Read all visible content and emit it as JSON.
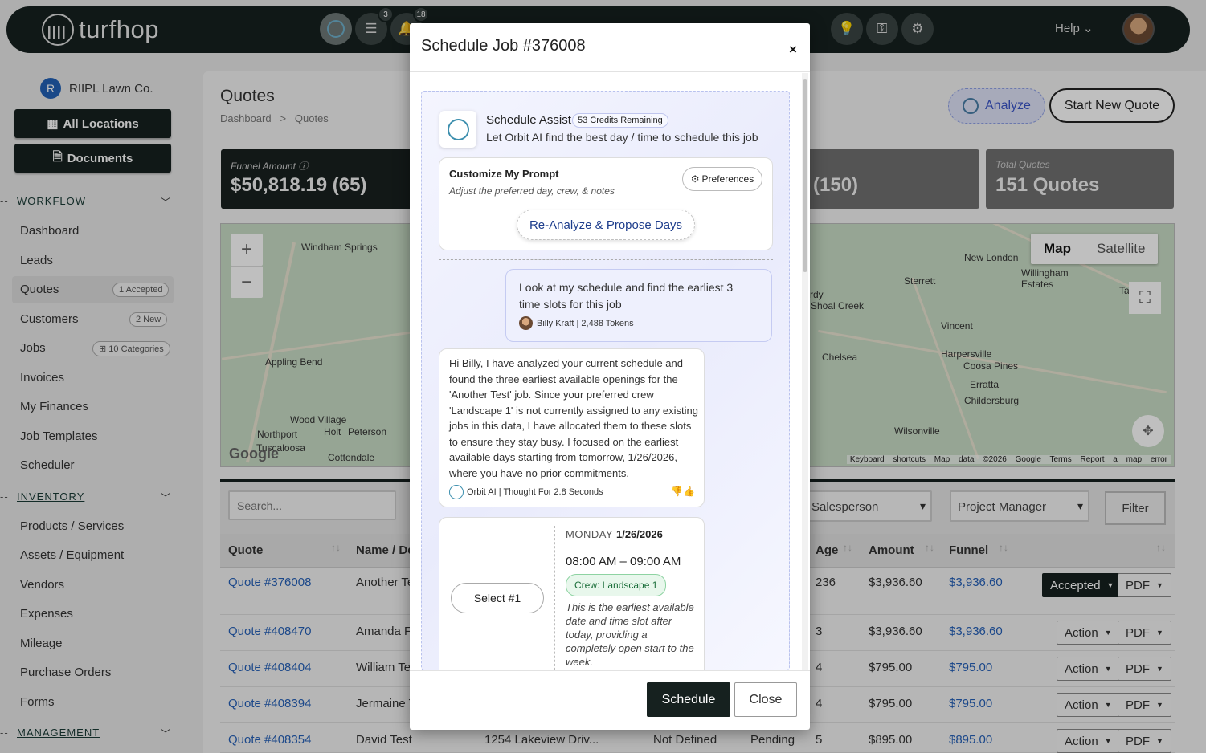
{
  "topbar": {
    "brand": "turfhop",
    "badge_list": "3",
    "badge_bell": "18",
    "help": "Help"
  },
  "sidebar": {
    "org": "RIIPL Lawn Co.",
    "org_initial": "R",
    "all_locations": "All Locations",
    "documents": "Documents",
    "workflow_label": "WORKFLOW",
    "inventory_label": "INVENTORY",
    "management_label": "MANAGEMENT",
    "workflow_items": [
      "Dashboard",
      "Leads",
      "Quotes",
      "Customers",
      "Jobs",
      "Invoices",
      "My Finances",
      "Job Templates",
      "Scheduler"
    ],
    "quotes_pill": "1 Accepted",
    "customers_pill": "2 New",
    "jobs_pill": "10 Categories",
    "inventory_items": [
      "Products / Services",
      "Assets / Equipment",
      "Vendors",
      "Expenses",
      "Mileage",
      "Purchase Orders",
      "Forms"
    ]
  },
  "page": {
    "title": "Quotes",
    "crumb_1": "Dashboard",
    "crumb_sep": ">",
    "crumb_2": "Quotes",
    "analyze": "Analyze",
    "start_new": "Start New Quote"
  },
  "cards": {
    "funnel_label": "Funnel Amount",
    "funnel_value": "$50,818.19 (65)",
    "third_value": "(150)",
    "total_label": "Total Quotes",
    "total_value": "151 Quotes"
  },
  "map": {
    "map_label": "Map",
    "satellite_label": "Satellite",
    "places": [
      "Windham Springs",
      "Appling Bend",
      "Wood Village",
      "Northport",
      "Holt",
      "Peterson",
      "Tuscaloosa",
      "Cottondale",
      "New London",
      "Sterrett",
      "Willingham Estates",
      "Shoal Creek",
      "Vincent",
      "Chelsea",
      "Harpersville",
      "Coosa Pines",
      "Erratta",
      "Childersburg",
      "Wilsonville",
      "Tall",
      "rdy"
    ],
    "footer_keys": "Keyboard shortcuts",
    "footer_data": "Map data ©2026 Google",
    "footer_terms": "Terms",
    "footer_report": "Report a map error",
    "google": "Google"
  },
  "filters": {
    "search_placeholder": "Search...",
    "salesperson": "Salesperson",
    "project_manager": "Project Manager",
    "filter": "Filter"
  },
  "table": {
    "headers": {
      "quote": "Quote",
      "name": "Name / De",
      "age": "Age",
      "amount": "Amount",
      "funnel": "Funnel"
    },
    "rows": [
      {
        "quote": "Quote #376008",
        "name": "Another Te",
        "addr": "",
        "status1": "",
        "status2": "",
        "age": "236",
        "amount": "$3,936.60",
        "funnel": "$3,936.60",
        "action": "Accepted",
        "pdf": "PDF"
      },
      {
        "quote": "Quote #408470",
        "name": "Amanda Fr",
        "addr": "",
        "status1": "",
        "status2": "",
        "age": "3",
        "amount": "$3,936.60",
        "funnel": "$3,936.60",
        "action": "Action",
        "pdf": "PDF"
      },
      {
        "quote": "Quote #408404",
        "name": "William Te",
        "addr": "",
        "status1": "",
        "status2": "",
        "age": "4",
        "amount": "$795.00",
        "funnel": "$795.00",
        "action": "Action",
        "pdf": "PDF"
      },
      {
        "quote": "Quote #408394",
        "name": "Jermaine T",
        "addr": "",
        "status1": "",
        "status2": "",
        "age": "4",
        "amount": "$795.00",
        "funnel": "$795.00",
        "action": "Action",
        "pdf": "PDF"
      },
      {
        "quote": "Quote #408354",
        "name": "David Test",
        "addr": "1254 Lakeview Driv...",
        "status1": "Not Defined",
        "status2": "Pending",
        "age": "5",
        "amount": "$895.00",
        "funnel": "$895.00",
        "action": "Action",
        "pdf": "PDF"
      }
    ]
  },
  "modal": {
    "title": "Schedule Job #376008",
    "close_x": "×",
    "assist_title": "Schedule Assist",
    "credits": "53 Credits Remaining",
    "assist_sub": "Let Orbit AI find the best day / time to schedule this job",
    "customize_title": "Customize My Prompt",
    "customize_sub": "Adjust the preferred day, crew, & notes",
    "preferences": "Preferences",
    "reanalyze": "Re-Analyze & Propose Days",
    "user_msg": "Look at my schedule and find the earliest 3 time slots for this job",
    "user_meta": "Billy Kraft | 2,488 Tokens",
    "ai_msg": "Hi Billy, I have analyzed your current schedule and found the three earliest available openings for the 'Another Test' job. Since your preferred crew 'Landscape 1' is not currently assigned to any existing jobs in this data, I have allocated them to these slots to ensure they stay busy. I focused on the earliest available days starting from tomorrow, 1/26/2026, where you have no prior commitments.",
    "ai_meta": "Orbit AI | Thought For 2.8 Seconds",
    "slot": {
      "select": "Select #1",
      "weekday": "MONDAY",
      "date": "1/26/2026",
      "time": "08:00 AM – 09:00 AM",
      "crew": "Crew: Landscape 1",
      "note": "This is the earliest available date and time slot after today, providing a completely open start to the week."
    },
    "schedule_btn": "Schedule",
    "close_btn": "Close"
  },
  "colors": {
    "dark": "#16211f",
    "link": "#2661b8",
    "accent": "#3a54c8"
  }
}
